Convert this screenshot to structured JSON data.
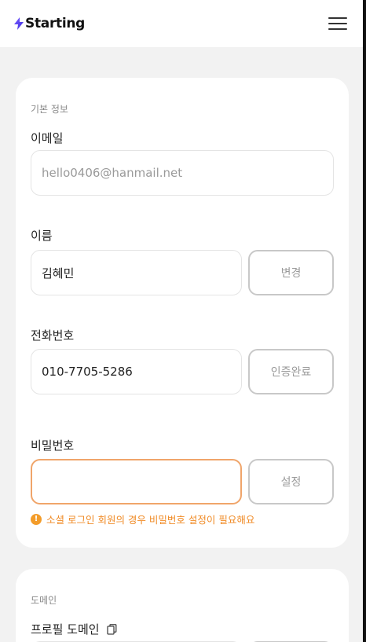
{
  "header": {
    "logo_text": "Starting",
    "logo_icon": "bolt-icon",
    "menu_icon": "hamburger-menu-icon"
  },
  "basic_info": {
    "section_title": "기본 정보",
    "email": {
      "label": "이메일",
      "value": "hello0406@hanmail.net"
    },
    "name": {
      "label": "이름",
      "value": "김혜민",
      "button": "변경"
    },
    "phone": {
      "label": "전화번호",
      "value": "010-7705-5286",
      "button": "인증완료"
    },
    "password": {
      "label": "비밀번호",
      "value": "",
      "button": "설정",
      "warning": "소셜 로그인 회원의 경우 비밀번호 설정이 필요해요"
    }
  },
  "domain": {
    "section_title": "도메인",
    "profile_domain_label": "프로필 도메인",
    "copy_icon": "copy-icon"
  },
  "colors": {
    "accent_warning": "#f08a24",
    "active_border": "#f0a56a",
    "brand_bolt": "#5b3df5"
  }
}
